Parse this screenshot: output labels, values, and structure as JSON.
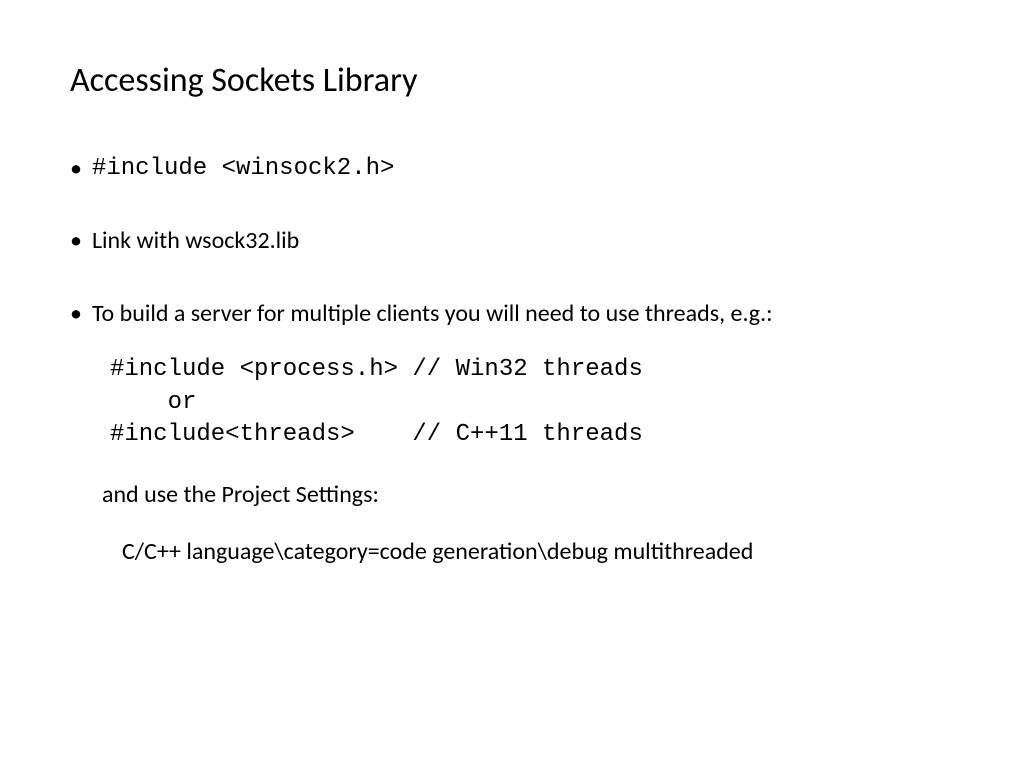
{
  "title": "Accessing Sockets Library",
  "bullets": [
    {
      "text": "#include <winsock2.h>",
      "mono": true
    },
    {
      "text": "Link with wsock32.lib",
      "mono": false
    },
    {
      "text": "To build a server for multiple clients you will need to use threads, e.g.:",
      "mono": false
    }
  ],
  "code_block": "#include <process.h> // Win32 threads\n    or\n#include<threads>    // C++11 threads",
  "sub_text1": "and use the Project Settings:",
  "sub_text2": "C/C++ language\\category=code generation\\debug multithreaded"
}
